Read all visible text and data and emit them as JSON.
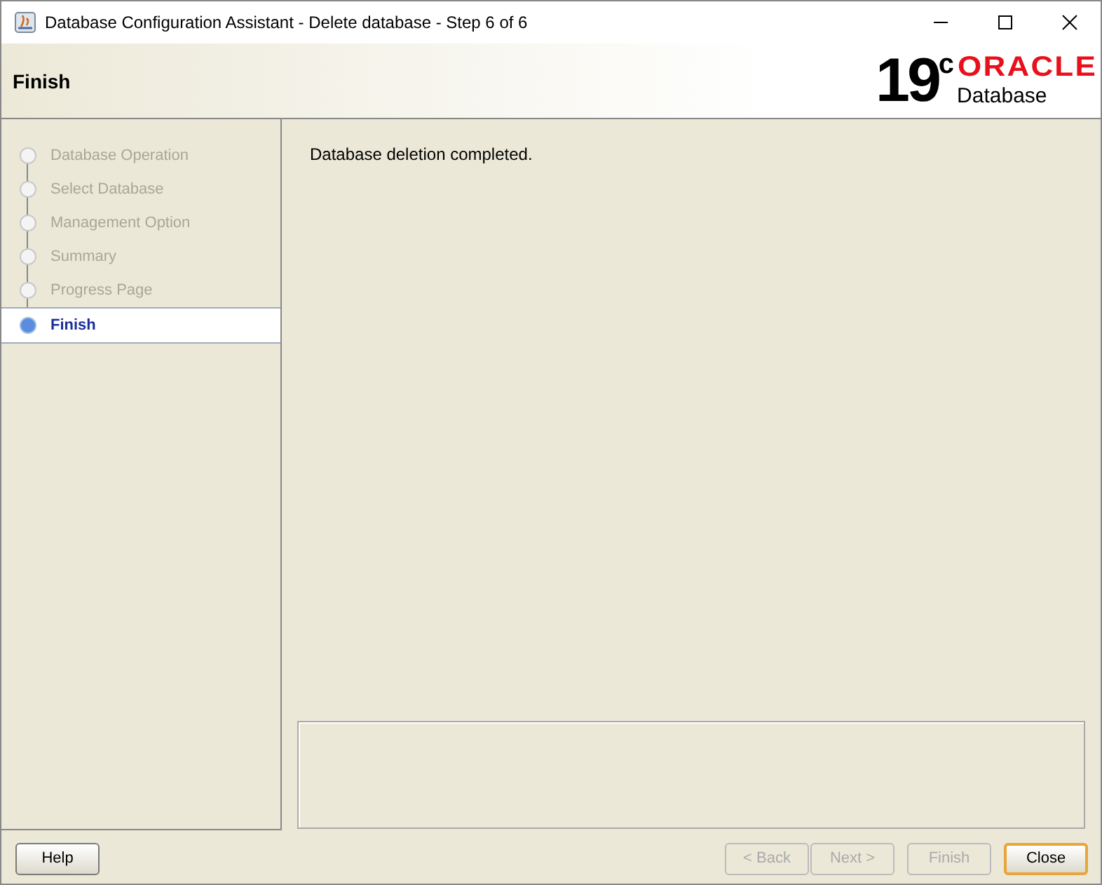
{
  "window": {
    "title": "Database Configuration Assistant - Delete database - Step 6 of 6"
  },
  "header": {
    "title": "Finish",
    "version": "19",
    "version_sup": "c",
    "brand": "ORACLE",
    "product": "Database"
  },
  "steps": [
    {
      "label": "Database Operation",
      "selected": false
    },
    {
      "label": "Select Database",
      "selected": false
    },
    {
      "label": "Management Option",
      "selected": false
    },
    {
      "label": "Summary",
      "selected": false
    },
    {
      "label": "Progress Page",
      "selected": false
    },
    {
      "label": "Finish",
      "selected": true
    }
  ],
  "message": "Database deletion completed.",
  "buttons": [
    {
      "label": "Help",
      "disabled": false,
      "default": false,
      "kind": "left"
    },
    {
      "label": "< Back",
      "disabled": true,
      "default": false,
      "kind": "right"
    },
    {
      "label": "Next >",
      "disabled": true,
      "default": false,
      "kind": "right"
    },
    {
      "label": "Finish",
      "disabled": true,
      "default": false,
      "kind": "right"
    },
    {
      "label": "Close",
      "disabled": false,
      "default": true,
      "kind": "right"
    }
  ]
}
